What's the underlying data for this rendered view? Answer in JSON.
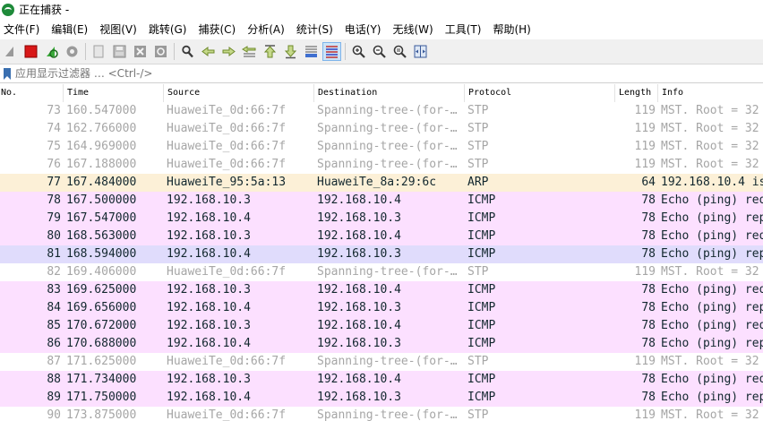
{
  "window": {
    "title": "正在捕获 -"
  },
  "menu": {
    "items": [
      "文件(F)",
      "编辑(E)",
      "视图(V)",
      "跳转(G)",
      "捕获(C)",
      "分析(A)",
      "统计(S)",
      "电话(Y)",
      "无线(W)",
      "工具(T)",
      "帮助(H)"
    ]
  },
  "toolbar": {
    "icons": [
      "shark-fin-icon",
      "stop-square-icon",
      "restart-icon",
      "capture-options-icon",
      "open-file-icon",
      "save-icon",
      "close-file-icon",
      "reload-icon",
      "find-packet-icon",
      "go-back-icon",
      "go-forward-icon",
      "go-to-packet-icon",
      "go-first-icon",
      "go-last-icon",
      "autoscroll-icon",
      "colorize-icon",
      "zoom-in-icon",
      "zoom-out-icon",
      "zoom-normal-icon",
      "resize-columns-icon"
    ]
  },
  "filter": {
    "placeholder": "应用显示过滤器 … <Ctrl-/>"
  },
  "columns": [
    "No.",
    "Time",
    "Source",
    "Destination",
    "Protocol",
    "Length",
    "Info"
  ],
  "colors": {
    "stp_text": "#a6a6a6",
    "arp_bg": "#fcf0d7",
    "icmp_bg": "#fce0ff",
    "selected_bg": "#e0dcfc"
  },
  "packets": [
    {
      "no": "73",
      "time": "160.547000",
      "src": "HuaweiTe_0d:66:7f",
      "dst": "Spanning-tree-(for-…",
      "proto": "STP",
      "len": "119",
      "info": "MST. Root = 32",
      "kind": "stp"
    },
    {
      "no": "74",
      "time": "162.766000",
      "src": "HuaweiTe_0d:66:7f",
      "dst": "Spanning-tree-(for-…",
      "proto": "STP",
      "len": "119",
      "info": "MST. Root = 32",
      "kind": "stp"
    },
    {
      "no": "75",
      "time": "164.969000",
      "src": "HuaweiTe_0d:66:7f",
      "dst": "Spanning-tree-(for-…",
      "proto": "STP",
      "len": "119",
      "info": "MST. Root = 32",
      "kind": "stp"
    },
    {
      "no": "76",
      "time": "167.188000",
      "src": "HuaweiTe_0d:66:7f",
      "dst": "Spanning-tree-(for-…",
      "proto": "STP",
      "len": "119",
      "info": "MST. Root = 32",
      "kind": "stp"
    },
    {
      "no": "77",
      "time": "167.484000",
      "src": "HuaweiTe_95:5a:13",
      "dst": "HuaweiTe_8a:29:6c",
      "proto": "ARP",
      "len": "64",
      "info": "192.168.10.4 is",
      "kind": "arp"
    },
    {
      "no": "78",
      "time": "167.500000",
      "src": "192.168.10.3",
      "dst": "192.168.10.4",
      "proto": "ICMP",
      "len": "78",
      "info": "Echo (ping) req",
      "kind": "icmp"
    },
    {
      "no": "79",
      "time": "167.547000",
      "src": "192.168.10.4",
      "dst": "192.168.10.3",
      "proto": "ICMP",
      "len": "78",
      "info": "Echo (ping) rep",
      "kind": "icmp"
    },
    {
      "no": "80",
      "time": "168.563000",
      "src": "192.168.10.3",
      "dst": "192.168.10.4",
      "proto": "ICMP",
      "len": "78",
      "info": "Echo (ping) req",
      "kind": "icmp"
    },
    {
      "no": "81",
      "time": "168.594000",
      "src": "192.168.10.4",
      "dst": "192.168.10.3",
      "proto": "ICMP",
      "len": "78",
      "info": "Echo (ping) rep",
      "kind": "sel"
    },
    {
      "no": "82",
      "time": "169.406000",
      "src": "HuaweiTe_0d:66:7f",
      "dst": "Spanning-tree-(for-…",
      "proto": "STP",
      "len": "119",
      "info": "MST. Root = 32",
      "kind": "stp"
    },
    {
      "no": "83",
      "time": "169.625000",
      "src": "192.168.10.3",
      "dst": "192.168.10.4",
      "proto": "ICMP",
      "len": "78",
      "info": "Echo (ping) req",
      "kind": "icmp"
    },
    {
      "no": "84",
      "time": "169.656000",
      "src": "192.168.10.4",
      "dst": "192.168.10.3",
      "proto": "ICMP",
      "len": "78",
      "info": "Echo (ping) rep",
      "kind": "icmp"
    },
    {
      "no": "85",
      "time": "170.672000",
      "src": "192.168.10.3",
      "dst": "192.168.10.4",
      "proto": "ICMP",
      "len": "78",
      "info": "Echo (ping) req",
      "kind": "icmp"
    },
    {
      "no": "86",
      "time": "170.688000",
      "src": "192.168.10.4",
      "dst": "192.168.10.3",
      "proto": "ICMP",
      "len": "78",
      "info": "Echo (ping) rep",
      "kind": "icmp"
    },
    {
      "no": "87",
      "time": "171.625000",
      "src": "HuaweiTe_0d:66:7f",
      "dst": "Spanning-tree-(for-…",
      "proto": "STP",
      "len": "119",
      "info": "MST. Root = 32",
      "kind": "stp"
    },
    {
      "no": "88",
      "time": "171.734000",
      "src": "192.168.10.3",
      "dst": "192.168.10.4",
      "proto": "ICMP",
      "len": "78",
      "info": "Echo (ping) req",
      "kind": "icmp"
    },
    {
      "no": "89",
      "time": "171.750000",
      "src": "192.168.10.4",
      "dst": "192.168.10.3",
      "proto": "ICMP",
      "len": "78",
      "info": "Echo (ping) rep",
      "kind": "icmp"
    },
    {
      "no": "90",
      "time": "173.875000",
      "src": "HuaweiTe_0d:66:7f",
      "dst": "Spanning-tree-(for-…",
      "proto": "STP",
      "len": "119",
      "info": "MST. Root = 32",
      "kind": "stp"
    }
  ]
}
